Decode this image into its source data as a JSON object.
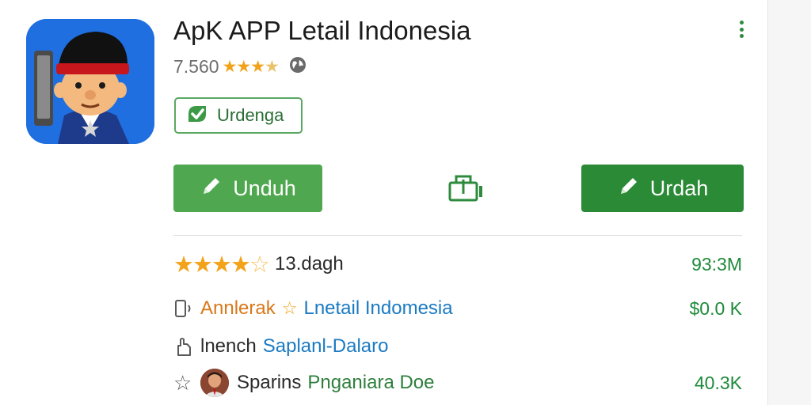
{
  "app": {
    "title": "ApK APP Letail Indonesia",
    "rating_count": "7.560",
    "icon": "app-mascot-icon"
  },
  "badge": {
    "label": "Urdenga",
    "icon": "check-icon"
  },
  "buttons": {
    "primary_label": "Unduh",
    "secondary_label": "Urdah",
    "icon": "pencil-icon",
    "share_icon": "share-icon"
  },
  "rows": [
    {
      "icon": "star-rating",
      "text": "13.dagh",
      "value": "93:3M"
    },
    {
      "icon": "phone-icon",
      "prefix": "Annlerak",
      "text": "Lnetail Indomesia",
      "value": "$0.0 K"
    },
    {
      "icon": "hand-icon",
      "prefix": "lnench",
      "text": "Saplanl-Dalaro",
      "value": ""
    },
    {
      "icon": "star-outline-icon",
      "prefix": "Sparins",
      "text": "Pnganiara Doe",
      "value": "40.3K"
    }
  ],
  "colors": {
    "accent_green": "#2a8a35",
    "button_green": "#4fa84f",
    "star": "#f3a31a",
    "link_blue": "#1b7ac2",
    "app_icon_bg": "#1f6fe0"
  }
}
